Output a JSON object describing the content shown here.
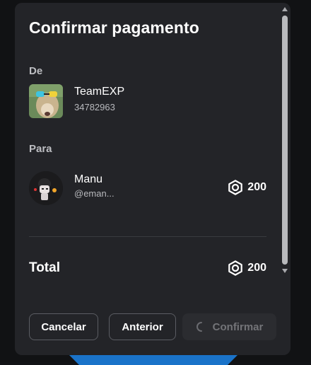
{
  "dialog": {
    "title": "Confirmar pagamento",
    "from_label": "De",
    "to_label": "Para",
    "total_label": "Total"
  },
  "from": {
    "name": "TeamEXP",
    "id": "34782963"
  },
  "to": {
    "name": "Manu",
    "handle": "@eman..."
  },
  "amount": {
    "recipient": "200",
    "total": "200",
    "currency_icon": "robux-icon"
  },
  "buttons": {
    "cancel": "Cancelar",
    "previous": "Anterior",
    "confirm": "Confirmar"
  },
  "colors": {
    "modal_bg": "#232428",
    "accent_blue": "#1a73c9"
  }
}
